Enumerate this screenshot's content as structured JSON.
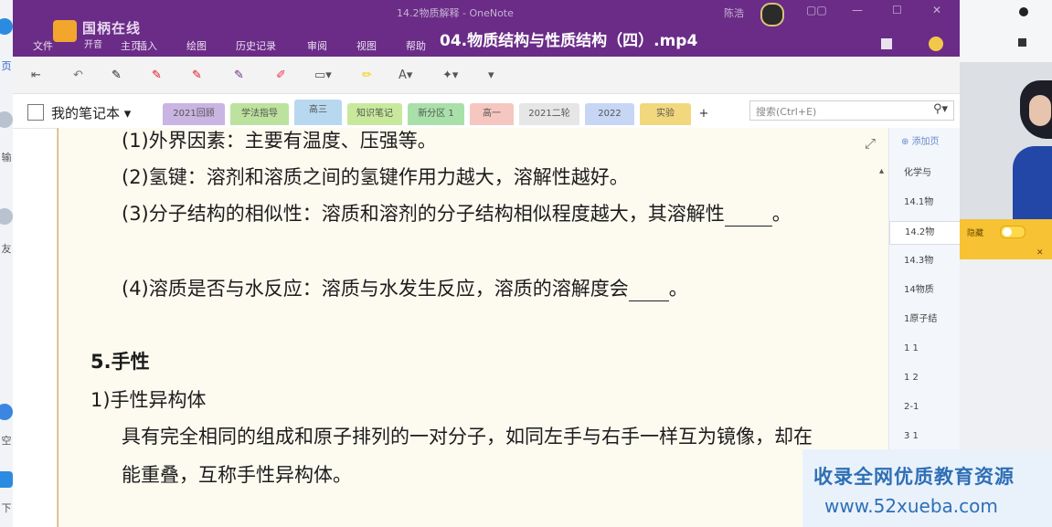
{
  "left_strip": {
    "items": [
      "页",
      "输",
      "友",
      "空",
      "下"
    ]
  },
  "titlebar": {
    "logo_line1": "国柄在线",
    "logo_line2": "开音",
    "window_title": "14.2物质解释 - OneNote",
    "user_name": "陈浩",
    "menu": [
      "文件",
      "主页",
      "插入",
      "绘图",
      "历史记录",
      "审阅",
      "视图",
      "帮助"
    ],
    "video_title": "04.物质结构与性质结构（四）.mp4"
  },
  "notebook": {
    "name": "我的笔记本",
    "tabs": [
      {
        "label": "2021回顾",
        "color": "#c9b4e2"
      },
      {
        "label": "学法指导",
        "color": "#bde29d"
      },
      {
        "label": "高三",
        "color": "#b8d8f0"
      },
      {
        "label": "知识笔记",
        "color": "#c8e99c"
      },
      {
        "label": "新分区 1",
        "color": "#a9e0a9"
      },
      {
        "label": "高一",
        "color": "#f5c7c0"
      },
      {
        "label": "2021二轮",
        "color": "#e6e6e6"
      },
      {
        "label": "2022",
        "color": "#c7d6f5"
      },
      {
        "label": "实验",
        "color": "#f2d87c"
      }
    ],
    "add_tab": "+",
    "search_placeholder": "搜索(Ctrl+E)"
  },
  "note": {
    "line1": "(1)外界因素：主要有温度、压强等。",
    "line2": "(2)氢键：溶剂和溶质之间的氢键作用力越大，溶解性越好。",
    "line3": "(3)分子结构的相似性：溶质和溶剂的分子结构相似程度越大，其溶解性",
    "line4": "(4)溶质是否与水反应：溶质与水发生反应，溶质的溶解度会",
    "period": "。",
    "heading": "5.手性",
    "subheading": "1)手性异构体",
    "para1": "具有完全相同的组成和原子排列的一对分子，如同左手与右手一样互为镜像，却在",
    "para2": "能重叠，互称手性异构体。"
  },
  "pages": {
    "add_label": "添加页",
    "items": [
      "化学与",
      "14.1物",
      "14.2物",
      "14.3物",
      "14物质",
      "1原子结",
      "1 1",
      "1 2",
      "2-1",
      "3 1"
    ],
    "selected_index": 2
  },
  "right_panel": {
    "toggle_label": "隐藏"
  },
  "watermark": {
    "line1": "收录全网优质教育资源",
    "line2": "www.52xueba.com"
  },
  "colors": {
    "titlebar": "#6a2c87",
    "page": "#fdfaf0",
    "watermark_text": "#2f6fb6"
  }
}
